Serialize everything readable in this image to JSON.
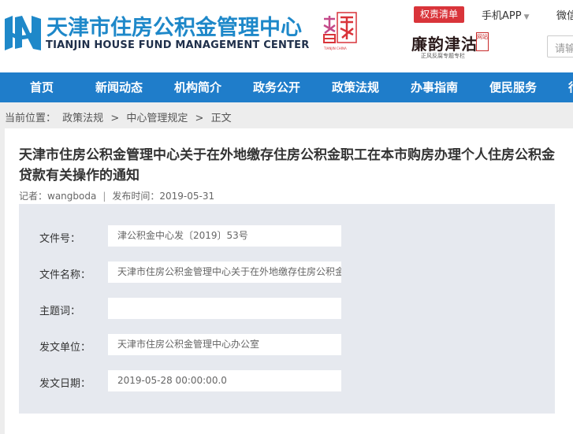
{
  "header": {
    "logo_cn": "天津市住房公积金管理中心",
    "logo_en": "TIANJIN HOUSE FUND MANAGEMENT CENTER",
    "emblem_sub": "TIANJIN CHINA",
    "badge_qz": "权责清单",
    "app_label": "手机APP",
    "weixin_label": "微信",
    "lianjie_main": "廉韵津沽",
    "lianjie_stamp": "网站",
    "lianjie_sub": "正风反腐专题专栏",
    "search_placeholder": "请输"
  },
  "nav": {
    "items": [
      "首页",
      "新闻动态",
      "机构简介",
      "政务公开",
      "政策法规",
      "办事指南",
      "便民服务",
      "行"
    ]
  },
  "breadcrumb": {
    "prefix": "当前位置：",
    "items": [
      "政策法规",
      "中心管理规定",
      "正文"
    ],
    "separator": ">"
  },
  "article": {
    "title": "天津市住房公积金管理中心关于在外地缴存住房公积金职工在本市购房办理个人住房公积金贷款有关操作的通知",
    "author": "记者：wangboda",
    "divider": "|",
    "date": "发布时间：2019-05-31"
  },
  "fields": [
    {
      "label": "文件号：",
      "value": "津公积金中心发〔2019〕53号"
    },
    {
      "label": "文件名称：",
      "value": "天津市住房公积金管理中心关于在外地缴存住房公积金"
    },
    {
      "label": "主题词：",
      "value": ""
    },
    {
      "label": "发文单位：",
      "value": "天津市住房公积金管理中心办公室"
    },
    {
      "label": "发文日期：",
      "value": "2019-05-28 00:00:00.0"
    }
  ],
  "colors": {
    "brand_blue": "#1e88c9",
    "nav_blue": "#1f7dca",
    "badge_red": "#d9343a"
  }
}
